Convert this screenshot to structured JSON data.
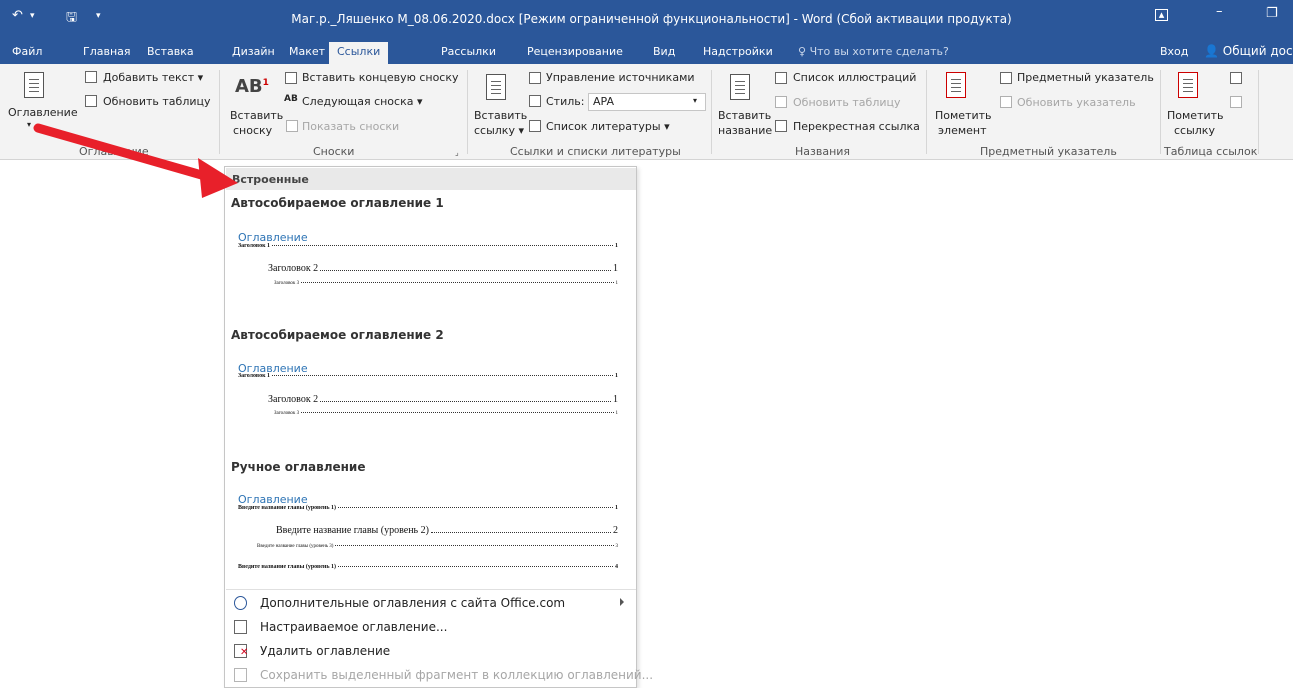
{
  "titlebar": {
    "title": "Маг.р._Ляшенко М_08.06.2020.docx [Режим ограниченной функциональности] - Word (Сбой активации продукта)"
  },
  "tabs": {
    "items": [
      "Файл",
      "Главная",
      "Вставка",
      "Дизайн",
      "Макет",
      "Ссылки",
      "Рассылки",
      "Рецензирование",
      "Вид",
      "Надстройки"
    ],
    "active": "Ссылки",
    "tell_me": "Что вы хотите сделать?",
    "signin": "Вход",
    "share": "Общий дост"
  },
  "ribbon": {
    "toc": {
      "button": "Оглавление",
      "add_text": "Добавить текст",
      "update_table": "Обновить таблицу",
      "group": "Оглавление"
    },
    "footnotes": {
      "insert_footnote_1": "Вставить",
      "insert_footnote_2": "сноску",
      "insert_endnote": "Вставить концевую сноску",
      "next_footnote": "Следующая сноска",
      "show_notes": "Показать сноски",
      "group": "Сноски"
    },
    "citations": {
      "insert_citation_1": "Вставить",
      "insert_citation_2": "ссылку",
      "manage_sources": "Управление источниками",
      "style_label": "Стиль:",
      "style_value": "APA",
      "bibliography": "Список литературы",
      "group": "Ссылки и списки литературы"
    },
    "captions": {
      "insert_caption_1": "Вставить",
      "insert_caption_2": "название",
      "table_of_figures": "Список иллюстраций",
      "update_table": "Обновить таблицу",
      "cross_reference": "Перекрестная ссылка",
      "group": "Названия"
    },
    "index": {
      "mark_entry_1": "Пометить",
      "mark_entry_2": "элемент",
      "insert_index": "Предметный указатель",
      "update_index": "Обновить указатель",
      "group": "Предметный указатель"
    },
    "authorities": {
      "mark_citation_1": "Пометить",
      "mark_citation_2": "ссылку",
      "group": "Таблица ссылок"
    }
  },
  "gallery": {
    "header": "Встроенные",
    "auto1": {
      "title": "Автособираемое оглавление 1",
      "heading": "Оглавление",
      "lines": [
        {
          "text": "Заголовок 1",
          "page": "1"
        },
        {
          "text": "Заголовок 2",
          "page": "1"
        },
        {
          "text": "Заголовок 3",
          "page": "1"
        }
      ]
    },
    "auto2": {
      "title": "Автособираемое оглавление 2",
      "heading": "Оглавление",
      "lines": [
        {
          "text": "Заголовок 1",
          "page": "1"
        },
        {
          "text": "Заголовок 2",
          "page": "1"
        },
        {
          "text": "Заголовок 3",
          "page": "1"
        }
      ]
    },
    "manual": {
      "title": "Ручное оглавление",
      "heading": "Оглавление",
      "lines": [
        {
          "text": "Введите название главы (уровень 1)",
          "page": "1"
        },
        {
          "text": "Введите название главы (уровень 2)",
          "page": "2"
        },
        {
          "text": "Введите название главы (уровень 3)",
          "page": "3"
        },
        {
          "text": "Введите название главы (уровень 1)",
          "page": "4"
        }
      ]
    },
    "menu": [
      "Дополнительные оглавления с сайта Office.com",
      "Настраиваемое оглавление...",
      "Удалить оглавление",
      "Сохранить выделенный фрагмент в коллекцию оглавлений..."
    ]
  },
  "colors": {
    "word_blue": "#2b579a",
    "arrow_red": "#e8202a",
    "toc_heading_blue": "#2e74b5"
  }
}
